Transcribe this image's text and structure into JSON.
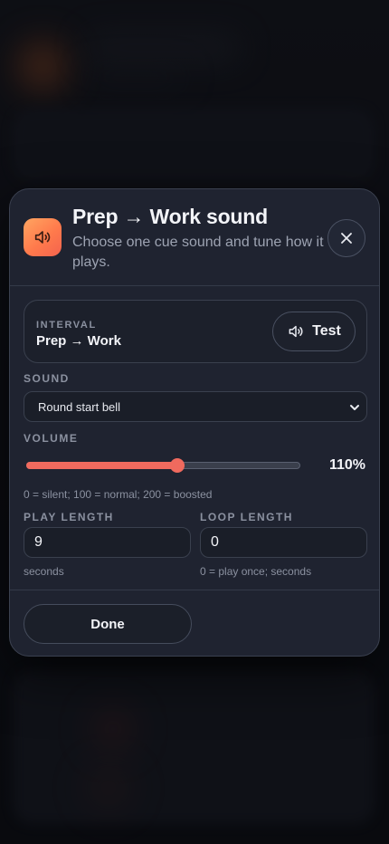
{
  "dialog": {
    "title": "Prep → Work sound",
    "subtitle": "Choose one cue sound and tune how it plays.",
    "close_icon": "close-icon",
    "app_icon": "speaker-icon"
  },
  "interval": {
    "label": "INTERVAL",
    "value": "Prep → Work",
    "test_label": "Test"
  },
  "sound": {
    "label": "SOUND",
    "selected": "Round start bell"
  },
  "volume": {
    "label": "VOLUME",
    "value": 110,
    "max": 200,
    "display": "110%",
    "hint": "0 = silent; 100 = normal; 200 = boosted"
  },
  "play_length": {
    "label": "PLAY LENGTH",
    "value": "9",
    "hint": "seconds"
  },
  "loop_length": {
    "label": "LOOP LENGTH",
    "value": "0",
    "hint": "0 = play once; seconds"
  },
  "footer": {
    "done_label": "Done"
  },
  "colors": {
    "accent": "#f06a5e",
    "icon_gradient_start": "#ffa561",
    "icon_gradient_end": "#f4634e",
    "surface": "#1f2330"
  }
}
